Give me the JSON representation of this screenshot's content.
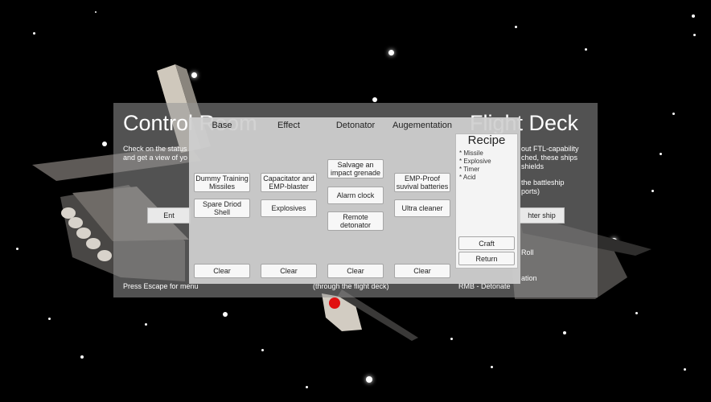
{
  "background_panel": {
    "title_left": "Control Room",
    "title_right": "Flight Deck",
    "left_text_line1": "Check on the status",
    "left_text_line2": "and get a view of yo",
    "right_text_line1": "out FTL-capability",
    "right_text_line2": "ched, these ships",
    "right_text_line3": "shields",
    "right_text_line4": "the battleship",
    "right_text_line5": "ports)",
    "enter_button_label": "Ent",
    "fighter_button_label": "hter ship",
    "hint_escape": "Press Escape for menu",
    "hint_middle": "(through the flight deck)",
    "hint_roll": "Roll",
    "hint_rotation": "ation",
    "hint_rmb": "RMB - Detonate"
  },
  "crafting": {
    "columns": [
      {
        "header": "Base",
        "items": [
          "Dummy Training Missiles",
          "Spare Driod Shell"
        ],
        "clear_label": "Clear"
      },
      {
        "header": "Effect",
        "items": [
          "Capacitator and EMP-blaster",
          "Explosives"
        ],
        "clear_label": "Clear"
      },
      {
        "header": "Detonator",
        "items": [
          "Salvage an impact grenade",
          "Alarm clock",
          "Remote detonator"
        ],
        "clear_label": "Clear"
      },
      {
        "header": "Augementation",
        "items": [
          "EMP-Proof suvival batteries",
          "Ultra cleaner"
        ],
        "clear_label": "Clear"
      }
    ],
    "recipe": {
      "title": "Recipe",
      "items": [
        "* Missile",
        "* Explosive",
        "* Timer",
        "* Acid"
      ],
      "craft_label": "Craft",
      "return_label": "Return"
    }
  }
}
